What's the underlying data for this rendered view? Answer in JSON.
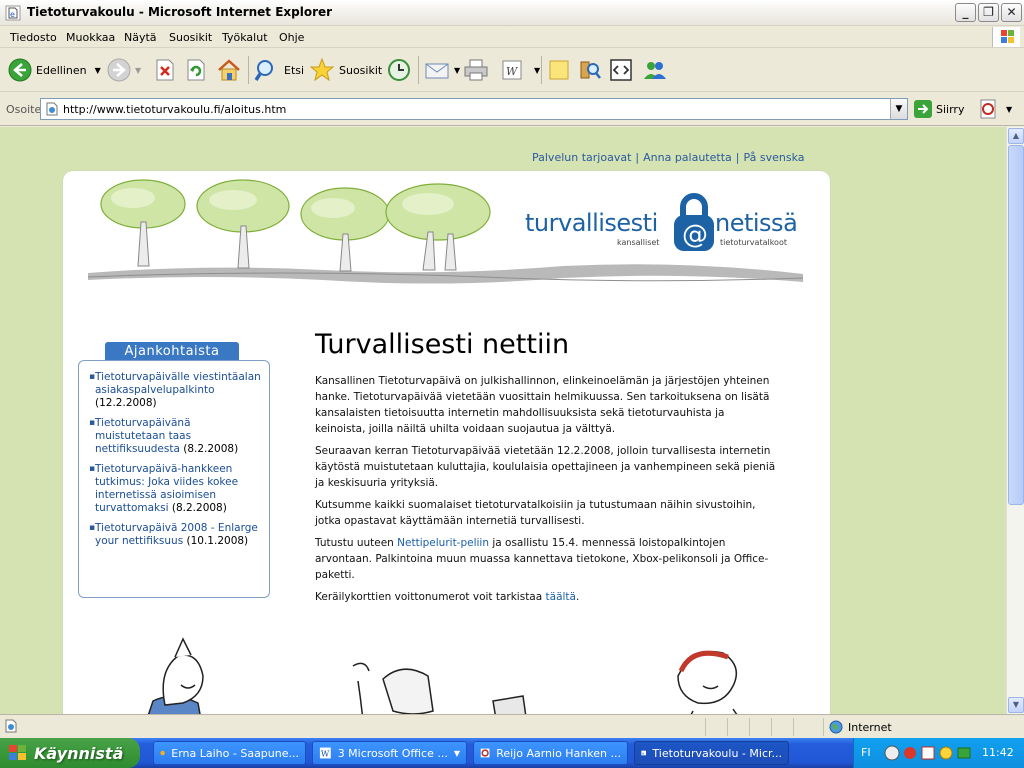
{
  "window": {
    "title": "Tietoturvakoulu - Microsoft Internet Explorer",
    "min": "_",
    "max": "❐",
    "close": "✕"
  },
  "menu": [
    "Tiedosto",
    "Muokkaa",
    "Näytä",
    "Suosikit",
    "Työkalut",
    "Ohje"
  ],
  "toolbar": {
    "back": "Edellinen",
    "search": "Etsi",
    "favorites": "Suosikit"
  },
  "address": {
    "label": "Osoite",
    "url": "http://www.tietoturvakoulu.fi/aloitus.htm",
    "go": "Siirry"
  },
  "page": {
    "toplinks": [
      "Palvelun tarjoavat",
      "Anna palautetta",
      "På svenska"
    ],
    "logo": {
      "word1": "turvallisesti",
      "word2": "netissä",
      "sub1": "kansalliset",
      "sub2": "tietoturvatalkoot",
      "at": "@"
    },
    "sidebar": {
      "tab": "Ajankohtaista",
      "items": [
        {
          "link": "Tietoturvapäivälle viestintäalan asiakaspalvelupalkinto",
          "date": "(12.2.2008)"
        },
        {
          "link": "Tietoturvapäivänä muistutetaan taas nettifiksuudesta",
          "date": "(8.2.2008)"
        },
        {
          "link": "Tietoturvapäivä-hankkeen tutkimus: Joka viides kokee internetissä asioimisen turvattomaksi",
          "date": "(8.2.2008)"
        },
        {
          "link": "Tietoturvapäivä 2008 - Enlarge your nettifiksuus",
          "date": "(10.1.2008)"
        }
      ]
    },
    "title": "Turvallisesti nettiin",
    "p1": "Kansallinen Tietoturvapäivä on julkishallinnon, elinkeinoelämän ja järjestöjen yhteinen hanke. Tietoturvapäivää vietetään vuosittain helmikuussa. Sen tarkoituksena on lisätä kansalaisten tietoisuutta internetin mahdollisuuksista sekä tietoturvauhista ja keinoista, joilla näiltä uhilta voidaan suojautua ja välttyä.",
    "p2": "Seuraavan kerran Tietoturvapäivää vietetään 12.2.2008, jolloin turvallisesta internetin käytöstä muistutetaan kuluttajia, koululaisia opettajineen ja vanhempineen sekä pieniä ja keskisuuria yrityksiä.",
    "p3": "Kutsumme kaikki suomalaiset tietoturvatalkoisiin ja tutustumaan näihin sivustoihin, jotka opastavat käyttämään internetiä turvallisesti.",
    "p4a": "Tutustu uuteen ",
    "p4link": "Nettipelurit-peliin",
    "p4b": " ja osallistu 15.4. mennessä loistopalkintojen arvontaan. Palkintoina muun muassa kannettava tietokone, Xbox-pelikonsoli ja Office-paketti.",
    "p5a": "Keräilykorttien voittonumerot voit tarkistaa ",
    "p5link": "täältä",
    "p5b": "."
  },
  "status": {
    "zone": "Internet"
  },
  "taskbar": {
    "start": "Käynnistä",
    "tasks": [
      "Erna Laiho - Saapune...",
      "3 Microsoft Office ...",
      "Reijo Aarnio Hanken ...",
      "Tietoturvakoulu - Micr..."
    ],
    "lang": "FI",
    "time": "11:42"
  }
}
